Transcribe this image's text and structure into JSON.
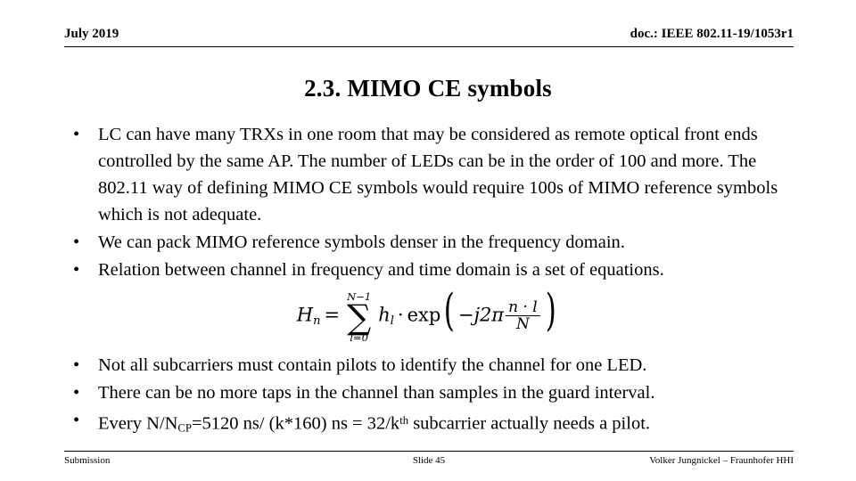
{
  "header": {
    "left": "July 2019",
    "right": "doc.: IEEE 802.11-19/1053r1"
  },
  "title": "2.3. MIMO CE symbols",
  "bullets_top": [
    {
      "marker": "•",
      "text": "LC can have many TRXs in one room that may be considered as remote optical front ends controlled by the same AP. The number of LEDs can be in the order of 100 and more. The 802.11 way of defining MIMO CE symbols would require 100s of MIMO reference symbols which is not adequate."
    },
    {
      "marker": "•",
      "text": "We can pack MIMO reference symbols denser in the frequency domain."
    },
    {
      "marker": "•",
      "text": "Relation between channel in frequency and time domain is a set of equations."
    }
  ],
  "equation": {
    "plain": "H_n = sum_{l=0}^{N-1} h_l · exp(-j2π (n·l)/N)",
    "lhs_base": "H",
    "lhs_sub": "n",
    "equals": "=",
    "sum_upper": "N−1",
    "sum_symbol": "∑",
    "sum_lower": "l=0",
    "term_base": "h",
    "term_sub": "l",
    "dot": "·",
    "exp": "exp",
    "paren_open": "(",
    "paren_close": ")",
    "phase_prefix": "−j2π",
    "frac_num": "n · l",
    "frac_den": "N"
  },
  "bullets_bottom": [
    {
      "marker": "•",
      "text": "Not all subcarriers must contain pilots to identify the channel for one LED."
    },
    {
      "marker": "•",
      "text": "There can be no more taps in the channel than samples in the guard interval."
    }
  ],
  "bullet_last": {
    "marker": "•",
    "part1": "Every N/N",
    "sub1": "CP",
    "part2": "=5120 ns/ (k*160) ns = 32/k",
    "sup1": "th",
    "part3": " subcarrier actually needs a pilot."
  },
  "footer": {
    "left": "Submission",
    "center": "Slide 45",
    "right": "Volker Jungnickel – Fraunhofer HHI"
  }
}
